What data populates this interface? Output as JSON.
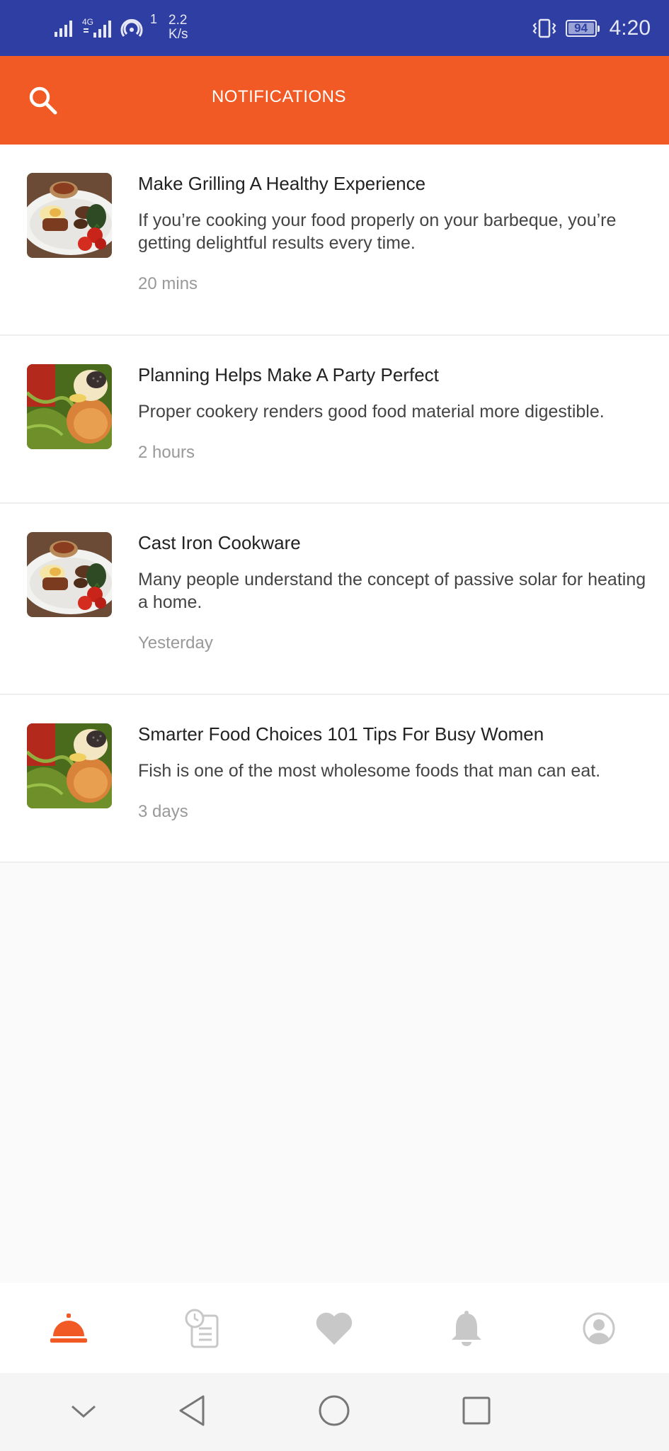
{
  "colors": {
    "status_bar": "#2f3ea3",
    "accent": "#f15a24",
    "tab_inactive": "#c8c8c8",
    "tab_active": "#f15a24"
  },
  "status_bar": {
    "signal_icon": "signal-bars-icon",
    "network_type": "4G",
    "hotspot_badge": "1",
    "speed_value": "2.2",
    "speed_unit": "K/s",
    "vibrate_icon": "vibrate-icon",
    "battery_level": "94",
    "time": "4:20"
  },
  "header": {
    "search_icon": "search-icon",
    "title": "NOTIFICATIONS"
  },
  "notifications": [
    {
      "image": "grilled-plate-thumbnail",
      "title": "Make Grilling A Healthy Experience",
      "description": "If you’re cooking your food properly on your barbeque, you’re getting delightful results every time.",
      "time": "20 mins"
    },
    {
      "image": "salad-dish-thumbnail",
      "title": "Planning Helps Make A Party Perfect",
      "description": "Proper cookery renders good food material more digestible.",
      "time": "2 hours"
    },
    {
      "image": "grilled-plate-thumbnail",
      "title": "Cast Iron Cookware",
      "description": "Many people understand the concept of passive solar for heating a home.",
      "time": "Yesterday"
    },
    {
      "image": "salad-dish-thumbnail",
      "title": "Smarter Food Choices 101 Tips For Busy Women",
      "description": "Fish is one of the most wholesome   foods that man can eat.",
      "time": "3 days"
    }
  ],
  "tab_bar": {
    "tabs": [
      {
        "icon": "cloche-icon",
        "active": true
      },
      {
        "icon": "order-history-icon",
        "active": false
      },
      {
        "icon": "heart-icon",
        "active": false
      },
      {
        "icon": "bell-icon",
        "active": false
      },
      {
        "icon": "profile-icon",
        "active": false
      }
    ]
  },
  "system_nav": {
    "buttons": [
      "chevron-down-icon",
      "back-icon",
      "home-icon",
      "recents-icon"
    ]
  }
}
